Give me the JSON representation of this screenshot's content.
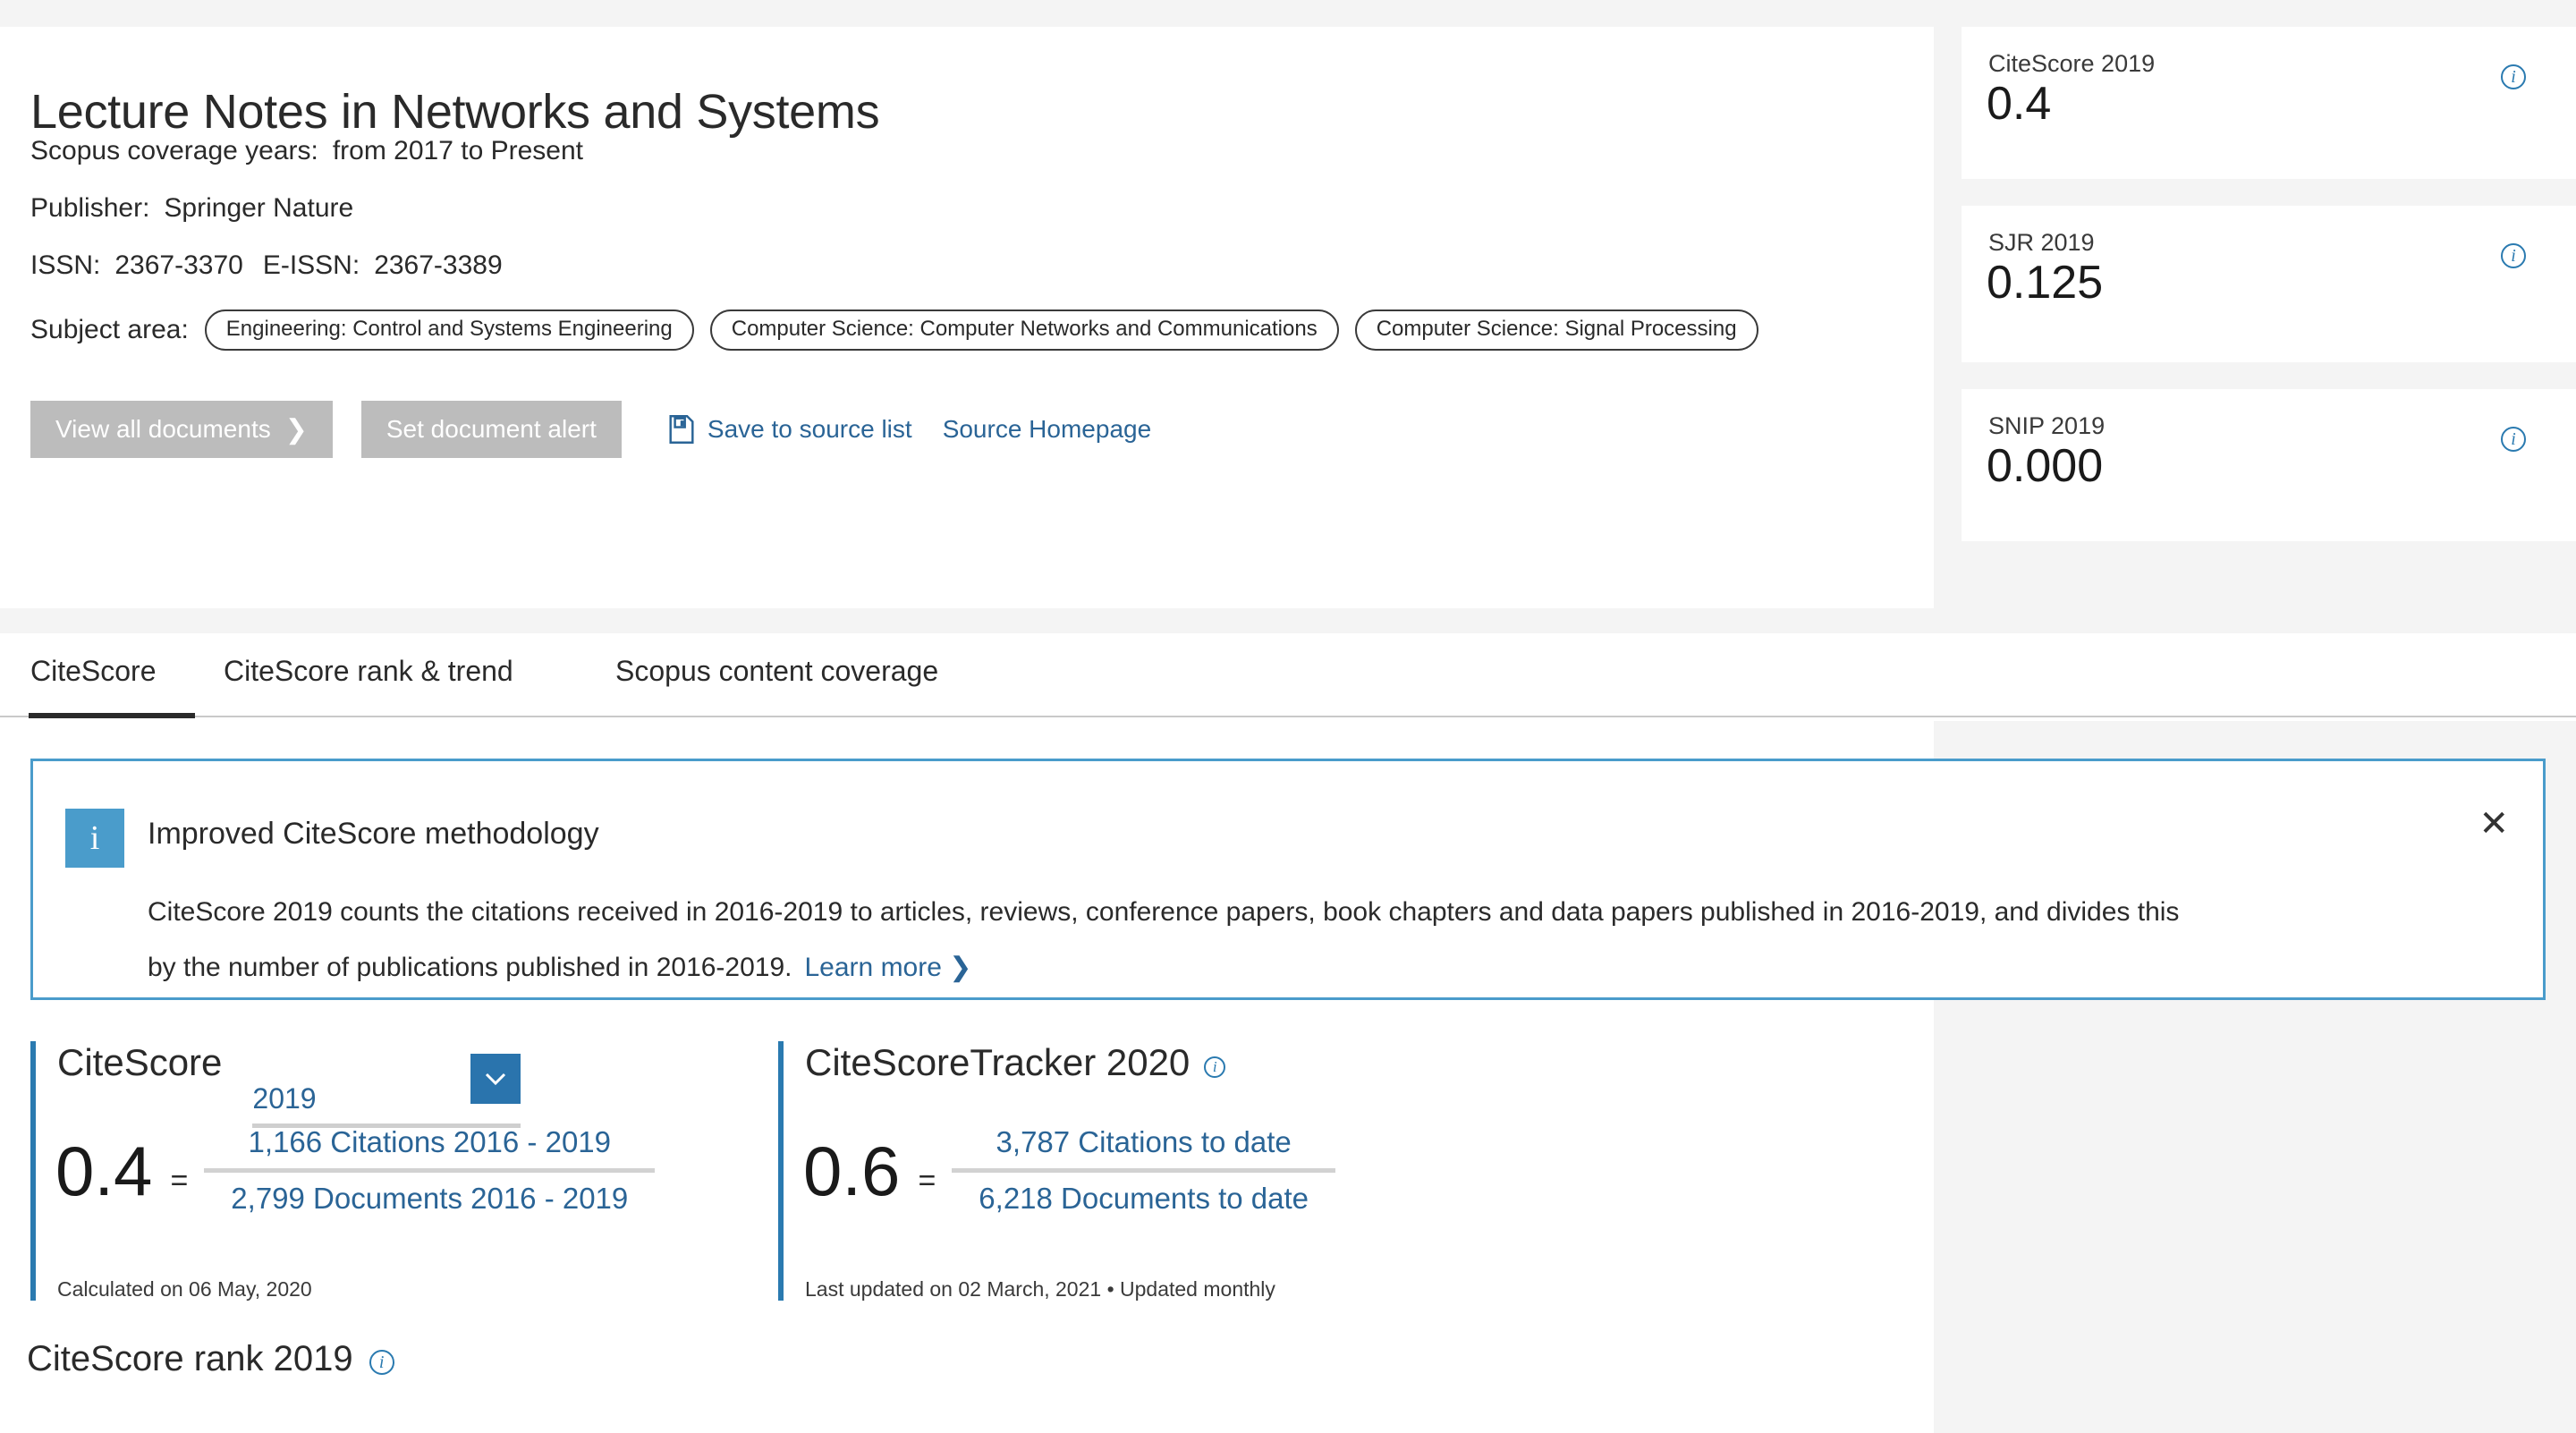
{
  "header": {
    "title": "Lecture Notes in Networks and Systems",
    "coverage_label": "Scopus coverage years:",
    "coverage_value": "from 2017 to Present",
    "publisher_label": "Publisher:",
    "publisher_value": "Springer Nature",
    "issn_label": "ISSN:",
    "issn_value": "2367-3370",
    "eissn_label": "E-ISSN:",
    "eissn_value": "2367-3389",
    "subject_label": "Subject area:",
    "subject_tags": [
      "Engineering: Control and Systems Engineering",
      "Computer Science: Computer Networks and Communications",
      "Computer Science: Signal Processing"
    ],
    "view_all_documents": "View all documents",
    "view_all_chevron": "❯",
    "set_document_alert": "Set document alert",
    "save_to_source_list": "Save to source list",
    "source_homepage": "Source Homepage"
  },
  "metrics": [
    {
      "label": "CiteScore 2019",
      "value": "0.4",
      "info": "i"
    },
    {
      "label": "SJR 2019",
      "value": "0.125",
      "info": "i"
    },
    {
      "label": "SNIP 2019",
      "value": "0.000",
      "info": "i"
    }
  ],
  "tabs": [
    {
      "label": "CiteScore",
      "active": true
    },
    {
      "label": "CiteScore rank & trend",
      "active": false
    },
    {
      "label": "Scopus content coverage",
      "active": false
    }
  ],
  "banner": {
    "icon": "i",
    "title": "Improved CiteScore methodology",
    "body": "CiteScore 2019 counts the citations received in 2016-2019 to articles, reviews, conference papers, book chapters and data papers published in 2016-2019, and divides this by the number of publications published in 2016-2019.",
    "learn_more": "Learn more ❯",
    "close": "✕"
  },
  "citescore_panel": {
    "title": "CiteScore",
    "year": "2019",
    "score": "0.4",
    "equals": "=",
    "numerator": "1,166 Citations 2016 - 2019",
    "denominator": "2,799 Documents 2016 - 2019",
    "note": "Calculated on 06 May, 2020"
  },
  "tracker_panel": {
    "title": "CiteScoreTracker 2020",
    "info": "i",
    "score": "0.6",
    "equals": "=",
    "numerator": "3,787 Citations to date",
    "denominator": "6,218 Documents to date",
    "note": "Last updated on 02 March, 2021 • Updated monthly"
  },
  "rank_section": {
    "heading": "CiteScore rank 2019",
    "info": "i"
  },
  "colors": {
    "accent_blue": "#2a7ab0",
    "link_blue": "#2a6496",
    "banner_blue": "#4a9ccb",
    "disabled_gray": "#bcbcbc",
    "page_gray": "#f4f4f4"
  }
}
